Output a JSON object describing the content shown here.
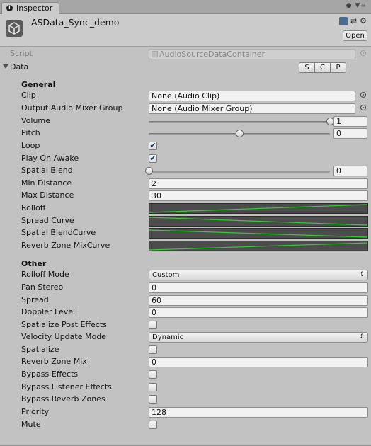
{
  "tab": {
    "label": "Inspector"
  },
  "header": {
    "object_name": "ASData_Sync_demo",
    "open_label": "Open"
  },
  "script_row": {
    "label": "Script",
    "value": "AudioSourceDataContainer"
  },
  "data_row": {
    "label": "Data",
    "buttons": [
      "S",
      "C",
      "P"
    ]
  },
  "general": {
    "heading": "General",
    "clip": {
      "label": "Clip",
      "value": "None (Audio Clip)"
    },
    "mixer": {
      "label": "Output Audio Mixer Group",
      "value": "None (Audio Mixer Group)"
    },
    "volume": {
      "label": "Volume",
      "value": "1",
      "slider": 1.0
    },
    "pitch": {
      "label": "Pitch",
      "value": "0",
      "slider": 0.5
    },
    "loop": {
      "label": "Loop",
      "checked": true
    },
    "play_on_awake": {
      "label": "Play On Awake",
      "checked": true
    },
    "spatial_blend": {
      "label": "Spatial Blend",
      "value": "0",
      "slider": 0.0
    },
    "min_distance": {
      "label": "Min Distance",
      "value": "2"
    },
    "max_distance": {
      "label": "Max Distance",
      "value": "30"
    },
    "rolloff": {
      "label": "Rolloff"
    },
    "spread_curve": {
      "label": "Spread Curve"
    },
    "spatial_blend_curve": {
      "label": "Spatial BlendCurve"
    },
    "reverb_curve": {
      "label": "Reverb Zone MixCurve"
    }
  },
  "other": {
    "heading": "Other",
    "rolloff_mode": {
      "label": "Rolloff Mode",
      "value": "Custom"
    },
    "pan_stereo": {
      "label": "Pan Stereo",
      "value": "0"
    },
    "spread": {
      "label": "Spread",
      "value": "60"
    },
    "doppler": {
      "label": "Doppler Level",
      "value": "0"
    },
    "spatialize_post": {
      "label": "Spatialize Post Effects",
      "checked": false
    },
    "velocity_mode": {
      "label": "Velocity Update Mode",
      "value": "Dynamic"
    },
    "spatialize": {
      "label": "Spatialize",
      "checked": false
    },
    "reverb_mix": {
      "label": "Reverb Zone Mix",
      "value": "0"
    },
    "bypass_effects": {
      "label": "Bypass Effects",
      "checked": false
    },
    "bypass_listener": {
      "label": "Bypass Listener Effects",
      "checked": false
    },
    "bypass_reverb": {
      "label": "Bypass Reverb Zones",
      "checked": false
    },
    "priority": {
      "label": "Priority",
      "value": "128"
    },
    "mute": {
      "label": "Mute",
      "checked": false
    }
  },
  "colors": {
    "curve_line": "#2fd12f",
    "curve_bg": "#4c4c4c",
    "panel_bg": "#c2c2c2"
  }
}
